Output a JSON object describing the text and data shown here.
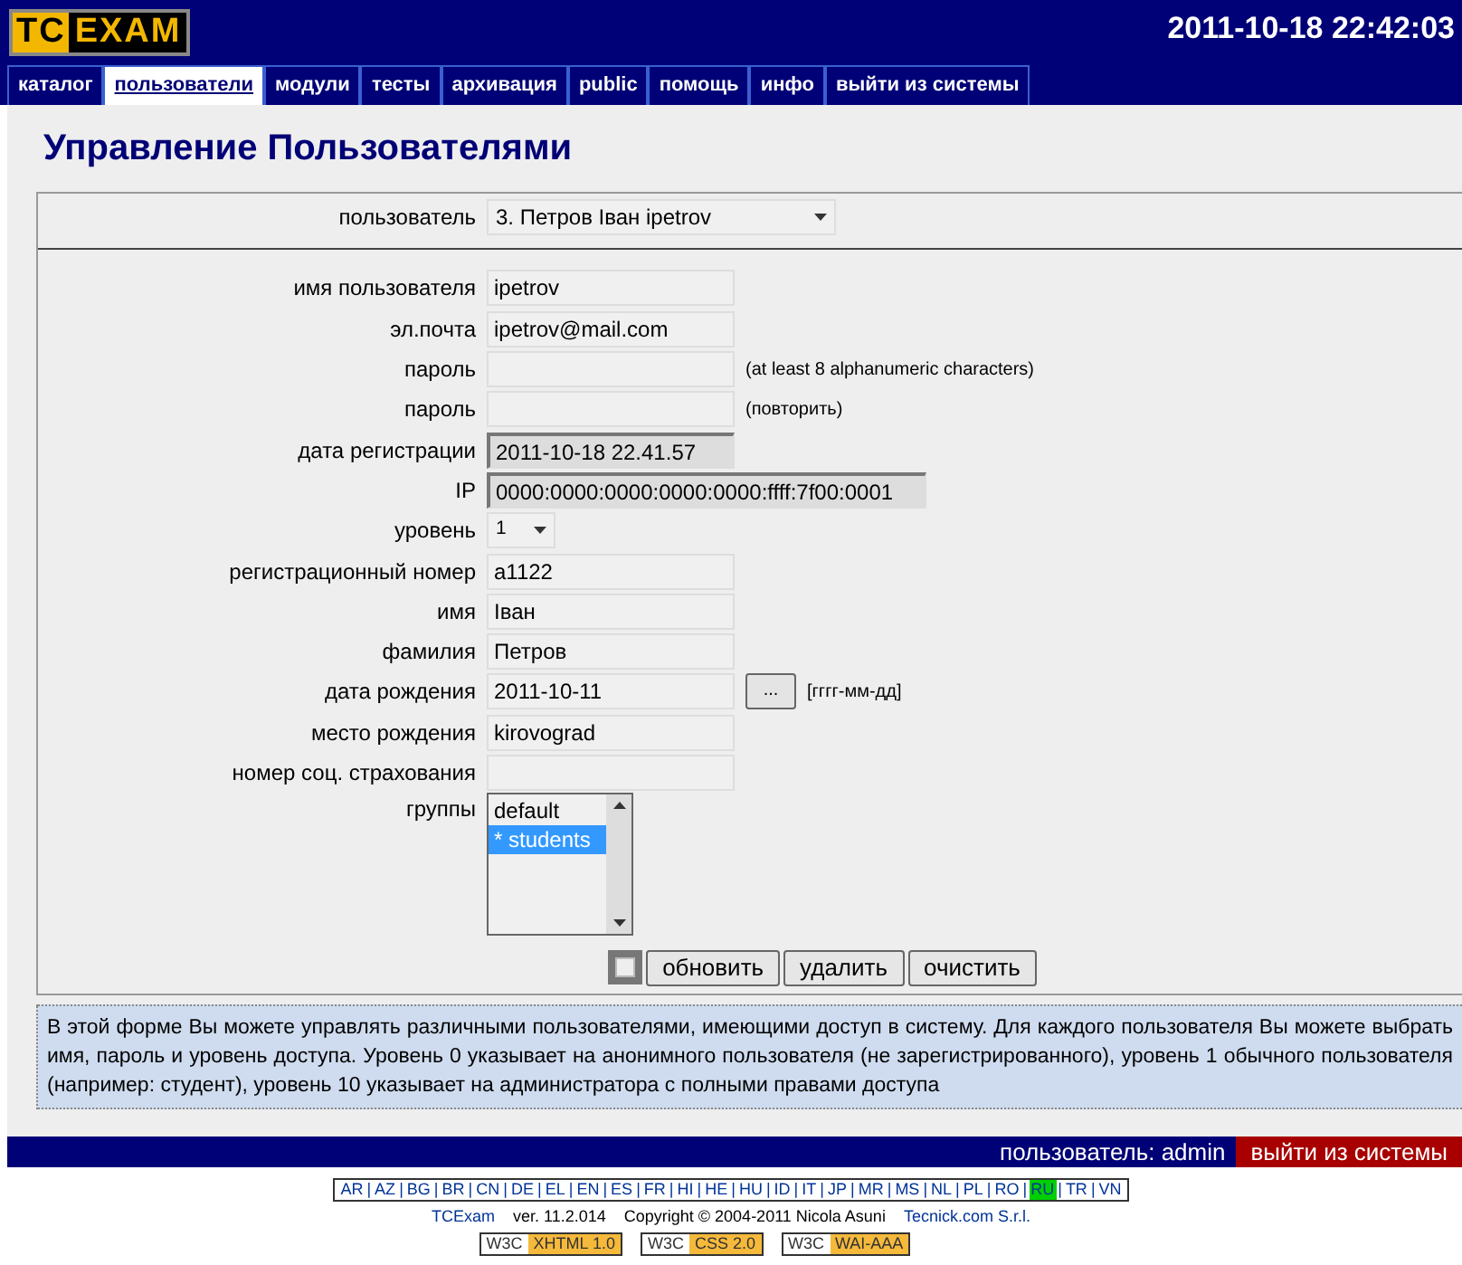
{
  "header": {
    "logo": {
      "part_1": "TC",
      "part_2": "EXAM"
    },
    "clock": "2011-10-18 22:42:03"
  },
  "tabs": [
    {
      "label": "каталог",
      "selected": false
    },
    {
      "label": "пользователи",
      "selected": true
    },
    {
      "label": "модули",
      "selected": false
    },
    {
      "label": "тесты",
      "selected": false
    },
    {
      "label": "архивация",
      "selected": false
    },
    {
      "label": "public",
      "selected": false
    },
    {
      "label": "помощь",
      "selected": false
    },
    {
      "label": "инфо",
      "selected": false
    },
    {
      "label": "выйти из системы",
      "selected": false
    }
  ],
  "title": "Управление Пользователями",
  "user_select": {
    "label": "пользователь",
    "value": "3. Петров Іван   ipetrov"
  },
  "fields": [
    {
      "kind": "text",
      "label": "имя пользователя",
      "value": "ipetrov"
    },
    {
      "kind": "text",
      "label": "эл.почта",
      "value": "ipetrov@mail.com"
    },
    {
      "kind": "password",
      "label": "пароль",
      "note": "(at least 8 alphanumeric characters)"
    },
    {
      "kind": "password",
      "label": "пароль",
      "note": "(повторить)"
    },
    {
      "kind": "readonly",
      "label": "дата регистрации",
      "value": "2011-10-18 22.41.57"
    },
    {
      "kind": "readonly-wide",
      "label": "IP",
      "value": "0000:0000:0000:0000:0000:ffff:7f00:0001"
    },
    {
      "kind": "select",
      "label": "уровень",
      "value": "1"
    },
    {
      "kind": "text",
      "label": "регистрационный номер",
      "value": "a1122"
    },
    {
      "kind": "text",
      "label": "имя",
      "value": "Іван"
    },
    {
      "kind": "text",
      "label": "фамилия",
      "value": "Петров"
    },
    {
      "kind": "date",
      "label": "дата рождения",
      "value": "2011-10-11",
      "button": "...",
      "note": "[гггг-мм-дд]"
    },
    {
      "kind": "text",
      "label": "место рождения",
      "value": "kirovograd"
    },
    {
      "kind": "text",
      "label": "номер соц. страхования"
    },
    {
      "kind": "listbox",
      "label": "группы",
      "options": [
        {
          "label": "default",
          "selected": false
        },
        {
          "label": "* students",
          "selected": true
        }
      ]
    }
  ],
  "actions": {
    "checked": false,
    "buttons": [
      "обновить",
      "удалить",
      "очистить"
    ]
  },
  "help": "В этой форме Вы можете управлять различными пользователями, имеющими доступ в систему. Для каждого пользователя Вы можете выбрать имя, пароль и уровень доступа. Уровень 0 указывает на анонимного пользователя (не зарегистрированного), уровень 1 обычного пользователя (например: студент), уровень 10 указывает на администратора с полными правами доступа",
  "footer_bar": {
    "user": "пользователь: admin",
    "logout": "выйти из системы"
  },
  "languages": [
    {
      "label": "AR",
      "selected": false
    },
    {
      "label": "AZ",
      "selected": false
    },
    {
      "label": "BG",
      "selected": false
    },
    {
      "label": "BR",
      "selected": false
    },
    {
      "label": "CN",
      "selected": false
    },
    {
      "label": "DE",
      "selected": false
    },
    {
      "label": "EL",
      "selected": false
    },
    {
      "label": "EN",
      "selected": false
    },
    {
      "label": "ES",
      "selected": false
    },
    {
      "label": "FR",
      "selected": false
    },
    {
      "label": "HI",
      "selected": false
    },
    {
      "label": "HE",
      "selected": false
    },
    {
      "label": "HU",
      "selected": false
    },
    {
      "label": "ID",
      "selected": false
    },
    {
      "label": "IT",
      "selected": false
    },
    {
      "label": "JP",
      "selected": false
    },
    {
      "label": "MR",
      "selected": false
    },
    {
      "label": "MS",
      "selected": false
    },
    {
      "label": "NL",
      "selected": false
    },
    {
      "label": "PL",
      "selected": false
    },
    {
      "label": "RO",
      "selected": false
    },
    {
      "label": "RU",
      "selected": true
    },
    {
      "label": "TR",
      "selected": false
    },
    {
      "label": "VN",
      "selected": false
    }
  ],
  "lang_separator": "|",
  "copyright": {
    "product": "TCExam",
    "version": "ver. 11.2.014",
    "text": "Copyright © 2004-2011 Nicola Asuni",
    "company": "Tecnick.com S.r.l."
  },
  "badges": [
    {
      "left": "W3C",
      "right": "XHTML 1.0"
    },
    {
      "left": "W3C",
      "right": "CSS 2.0"
    },
    {
      "left": "W3C",
      "right": "WAI-AAA"
    }
  ]
}
